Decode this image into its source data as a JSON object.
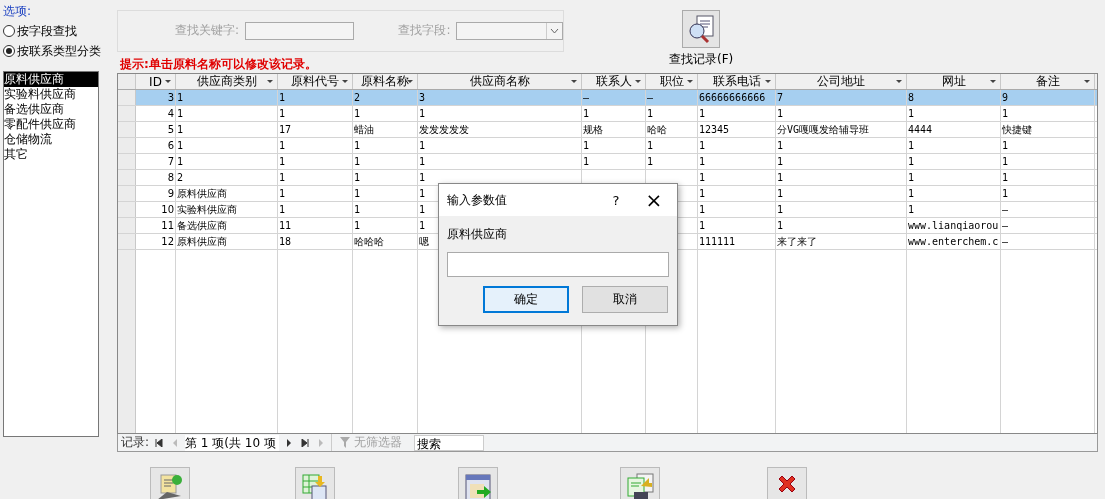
{
  "options": {
    "title": "选项:",
    "radios": [
      {
        "label": "按字段查找",
        "selected": false
      },
      {
        "label": "按联系类型分类",
        "selected": true
      }
    ]
  },
  "categories": [
    {
      "label": "原料供应商",
      "selected": true
    },
    {
      "label": "实验料供应商",
      "selected": false
    },
    {
      "label": "备选供应商",
      "selected": false
    },
    {
      "label": "零配件供应商",
      "selected": false
    },
    {
      "label": "仓储物流",
      "selected": false
    },
    {
      "label": "其它",
      "selected": false
    }
  ],
  "search": {
    "keyword_label": "查找关键字:",
    "field_label": "查找字段:",
    "find_button": "查找记录(F)",
    "disabled": true
  },
  "hint": "提示:单击原料名称可以修改该记录。",
  "table": {
    "columns": [
      "ID",
      "供应商类别",
      "原料代号",
      "原料名称",
      "供应商名称",
      "联系人",
      "职位",
      "联系电话",
      "公司地址",
      "网址",
      "备注"
    ],
    "rows": [
      {
        "selected": true,
        "cells": [
          "3",
          "1",
          "1",
          "2",
          "3",
          "—",
          "—",
          "66666666666",
          "7",
          "8",
          "9"
        ]
      },
      {
        "selected": false,
        "cells": [
          "4",
          "1",
          "1",
          "1",
          "1",
          "1",
          "1",
          "1",
          "1",
          "1",
          "1"
        ]
      },
      {
        "selected": false,
        "cells": [
          "5",
          "1",
          "17",
          "蜡油",
          "发发发发发",
          "规格",
          "哈哈",
          "12345",
          "分VG嘎嘎发给辅导班",
          "4444",
          "快捷键"
        ]
      },
      {
        "selected": false,
        "cells": [
          "6",
          "1",
          "1",
          "1",
          "1",
          "1",
          "1",
          "1",
          "1",
          "1",
          "1"
        ]
      },
      {
        "selected": false,
        "cells": [
          "7",
          "1",
          "1",
          "1",
          "1",
          "1",
          "1",
          "1",
          "1",
          "1",
          "1"
        ]
      },
      {
        "selected": false,
        "cells": [
          "8",
          "2",
          "1",
          "1",
          "1",
          null,
          null,
          "1",
          "1",
          "1",
          "1"
        ]
      },
      {
        "selected": false,
        "cells": [
          "9",
          "原料供应商",
          "1",
          "1",
          "1",
          null,
          null,
          "1",
          "1",
          "1",
          "1"
        ]
      },
      {
        "selected": false,
        "cells": [
          "10",
          "实验料供应商",
          "1",
          "1",
          "1",
          null,
          null,
          "1",
          "1",
          "1",
          "—"
        ]
      },
      {
        "selected": false,
        "cells": [
          "11",
          "备选供应商",
          "11",
          "1",
          "1",
          null,
          null,
          "1",
          "1",
          "www.lianqiaorou",
          "—"
        ]
      },
      {
        "selected": false,
        "cells": [
          "12",
          "原料供应商",
          "18",
          "哈哈哈",
          "嗯",
          null,
          null,
          "111111",
          "来了来了",
          "www.enterchem.c",
          "—"
        ]
      }
    ]
  },
  "navigator": {
    "label": "记录:",
    "position": "第 1 项(共 10 项",
    "filter": "无筛选器",
    "search": "搜索"
  },
  "dialog": {
    "title": "输入参数值",
    "help": "?",
    "close": "×",
    "prompt": "原料供应商",
    "ok": "确定",
    "cancel": "取消"
  }
}
